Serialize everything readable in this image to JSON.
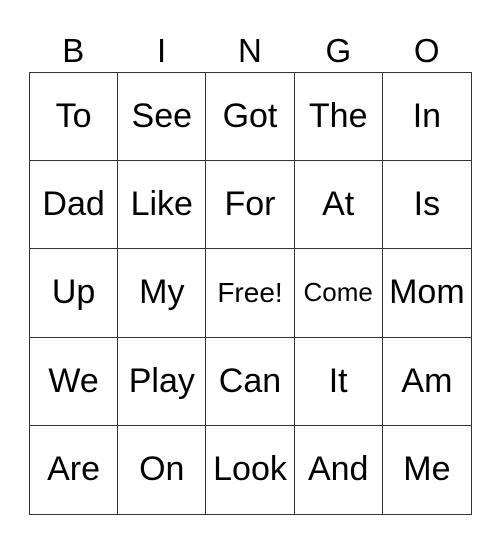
{
  "header": [
    "B",
    "I",
    "N",
    "G",
    "O"
  ],
  "cells": [
    [
      "To",
      "See",
      "Got",
      "The",
      "In"
    ],
    [
      "Dad",
      "Like",
      "For",
      "At",
      "Is"
    ],
    [
      "Up",
      "My",
      "Free!",
      "Come",
      "Mom"
    ],
    [
      "We",
      "Play",
      "Can",
      "It",
      "Am"
    ],
    [
      "Are",
      "On",
      "Look",
      "And",
      "Me"
    ]
  ]
}
